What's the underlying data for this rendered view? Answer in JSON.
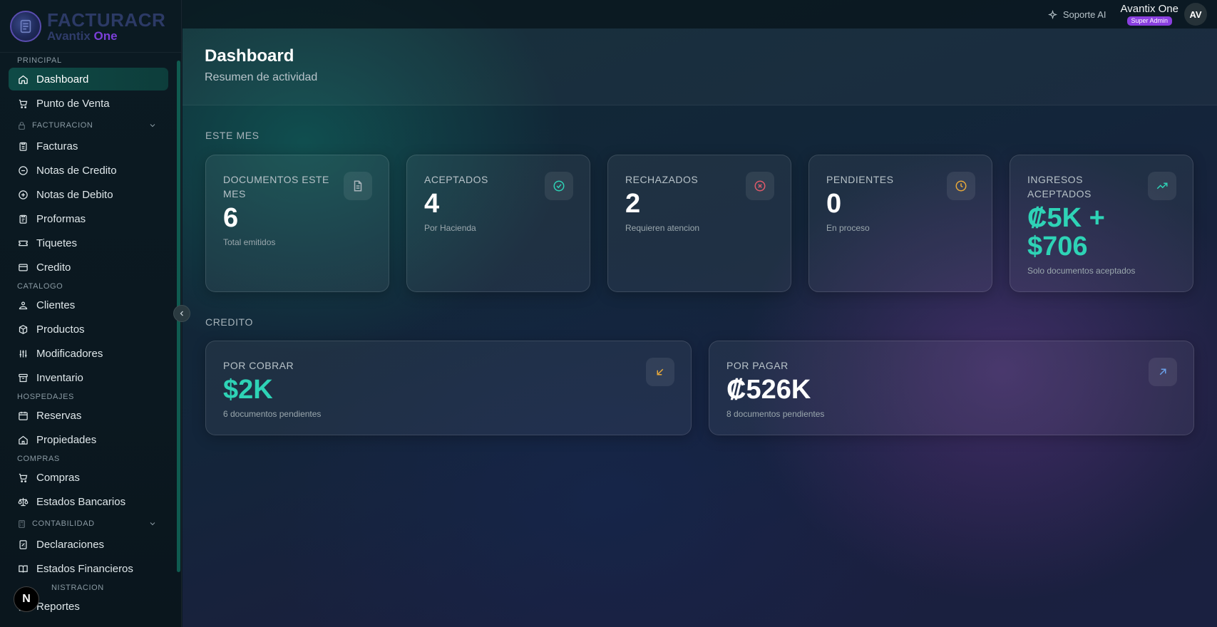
{
  "brand": {
    "name": "FACTURACR",
    "sub_a": "Avantix",
    "sub_b": "One"
  },
  "sidebar": {
    "sections": {
      "principal": "PRINCIPAL",
      "facturacion": "FACTURACION",
      "catalogo": "CATALOGO",
      "hospedajes": "HOSPEDAJES",
      "compras": "COMPRAS",
      "contabilidad": "CONTABILIDAD",
      "administracion": "NISTRACION"
    },
    "items": {
      "dashboard": "Dashboard",
      "punto_venta": "Punto de Venta",
      "facturas": "Facturas",
      "notas_credito": "Notas de Credito",
      "notas_debito": "Notas de Debito",
      "proformas": "Proformas",
      "tiquetes": "Tiquetes",
      "credito": "Credito",
      "clientes": "Clientes",
      "productos": "Productos",
      "modificadores": "Modificadores",
      "inventario": "Inventario",
      "reservas": "Reservas",
      "propiedades": "Propiedades",
      "compras": "Compras",
      "estados_bancarios": "Estados Bancarios",
      "declaraciones": "Declaraciones",
      "estados_financieros": "Estados Financieros",
      "reportes": "Reportes"
    },
    "badge": "N"
  },
  "topbar": {
    "support": "Soporte AI",
    "user_name": "Avantix One",
    "role": "Super Admin",
    "avatar": "AV"
  },
  "header": {
    "title": "Dashboard",
    "subtitle": "Resumen de actividad"
  },
  "este_mes": {
    "label": "ESTE MES",
    "cards": [
      {
        "label": "DOCUMENTOS ESTE MES",
        "value": "6",
        "note": "Total emitidos",
        "icon": "document-icon",
        "icon_color": "#a9b4ba"
      },
      {
        "label": "ACEPTADOS",
        "value": "4",
        "note": "Por Hacienda",
        "icon": "check-circle-icon",
        "icon_color": "#2ed3b6"
      },
      {
        "label": "RECHAZADOS",
        "value": "2",
        "note": "Requieren atencion",
        "icon": "x-circle-icon",
        "icon_color": "#e05a6a"
      },
      {
        "label": "PENDIENTES",
        "value": "0",
        "note": "En proceso",
        "icon": "clock-icon",
        "icon_color": "#e8a93a"
      },
      {
        "label": "INGRESOS ACEPTADOS",
        "value": "₡5K + $706",
        "note": "Solo documentos aceptados",
        "icon": "trend-up-icon",
        "icon_color": "#2ed3b6"
      }
    ]
  },
  "credito": {
    "label": "CREDITO",
    "cards": [
      {
        "label": "POR COBRAR",
        "value": "$2K",
        "note": "6 documentos pendientes",
        "icon": "arrow-down-left-icon",
        "icon_color": "#e8a93a"
      },
      {
        "label": "POR PAGAR",
        "value": "₡526K",
        "note": "8 documentos pendientes",
        "icon": "arrow-up-right-icon",
        "icon_color": "#6aa0e8"
      }
    ]
  },
  "colors": {
    "accent": "#2ed3b6",
    "brand_purple": "#7b3fd8",
    "active_nav": "#0f4a46"
  }
}
